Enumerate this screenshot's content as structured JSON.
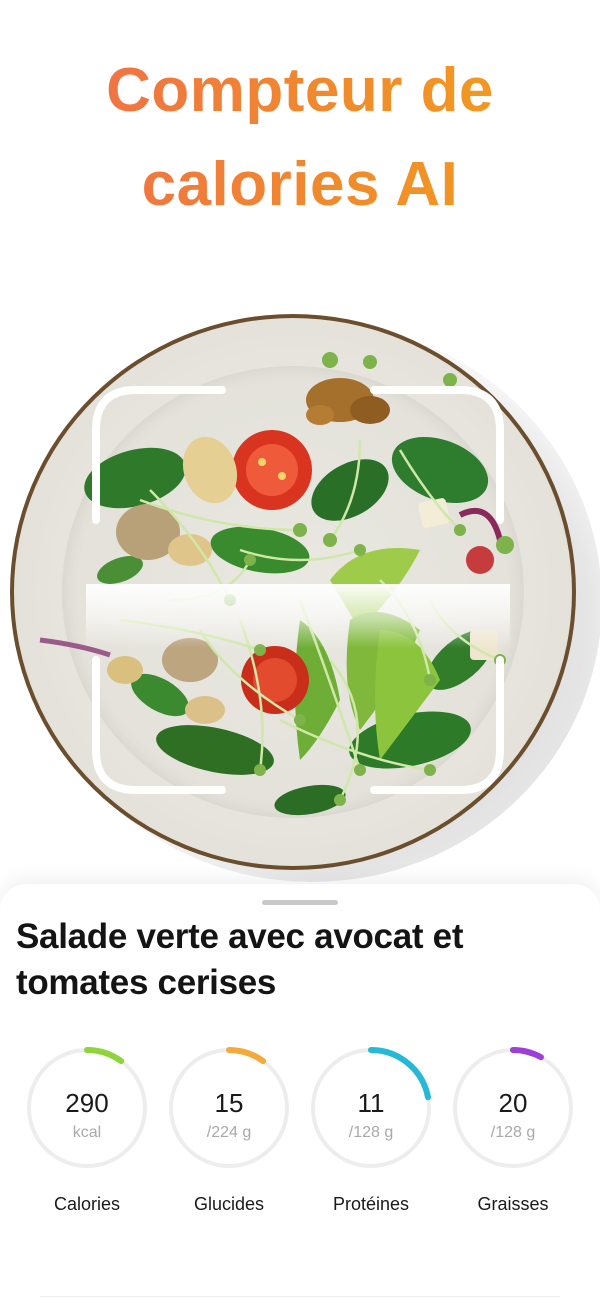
{
  "headline": {
    "line1": "Compteur de",
    "line2": "calories AI",
    "gradient_colors": [
      "#ef6a4e",
      "#f3a21a"
    ]
  },
  "photo": {
    "subject": "salad-plate-photo",
    "scanner": "scan-frame-corners"
  },
  "result": {
    "dish_name": "Salade verte avec avocat et tomates cerises"
  },
  "nutrients": [
    {
      "value": "290",
      "unit": "kcal",
      "label": "Calories",
      "progress": 0.1,
      "color": "#8fd43a"
    },
    {
      "value": "15",
      "unit": "/224 g",
      "label": "Glucides",
      "progress": 0.1,
      "color": "#f4a93a"
    },
    {
      "value": "11",
      "unit": "/128 g",
      "label": "Protéines",
      "progress": 0.22,
      "color": "#27b8d6"
    },
    {
      "value": "20",
      "unit": "/128 g",
      "label": "Graisses",
      "progress": 0.08,
      "color": "#9c3fd6"
    }
  ]
}
